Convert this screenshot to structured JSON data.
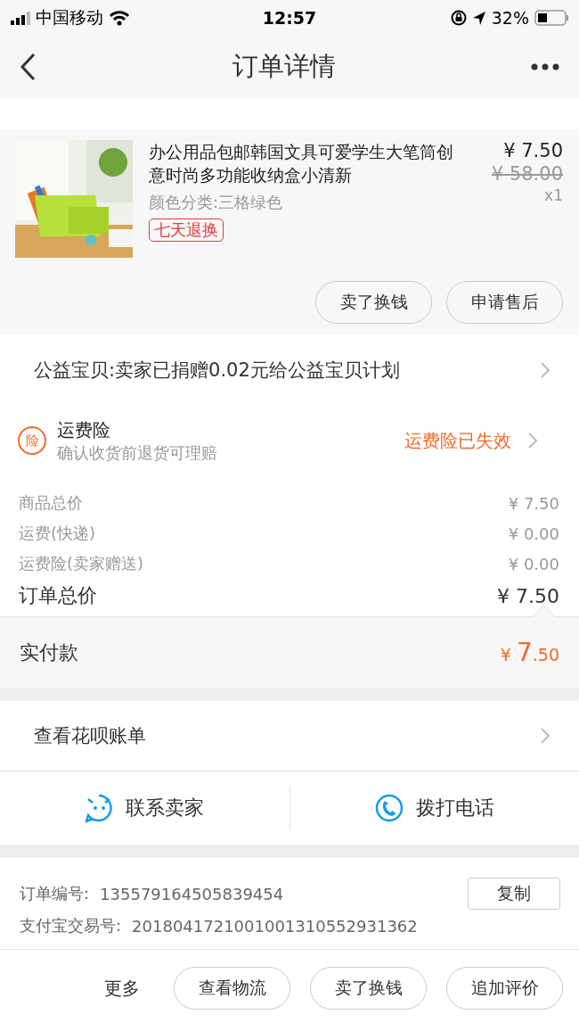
{
  "status_bar": {
    "carrier": "中国移动",
    "time": "12:57",
    "battery": "32%"
  },
  "nav": {
    "title": "订单详情"
  },
  "product": {
    "kind": "picture",
    "title": "办公用品包邮韩国文具可爱学生大笔筒创意时尚多功能收纳盒小清新",
    "sku": "颜色分类:三格绿色",
    "tag": "七天退换",
    "price": "¥ 7.50",
    "original_price": "¥ 58.00",
    "quantity": "x1",
    "buttons": [
      "卖了换钱",
      "申请售后"
    ]
  },
  "charity": {
    "text": "公益宝贝:卖家已捐赠0.02元给公益宝贝计划"
  },
  "insurance": {
    "badge": "险",
    "title": "运费险",
    "subtitle": "确认收货前退货可理赔",
    "status": "运费险已失效"
  },
  "price_lines": [
    {
      "label": "商品总价",
      "value": "¥ 7.50",
      "kind": "minor"
    },
    {
      "label": "运费(快递)",
      "value": "¥ 0.00",
      "kind": "minor"
    },
    {
      "label": "运费险(卖家赠送)",
      "value": "¥ 0.00",
      "kind": "minor"
    },
    {
      "label": "订单总价",
      "value": "¥ 7.50",
      "kind": "total"
    }
  ],
  "paid": {
    "label": "实付款",
    "currency": "¥",
    "integer": "7",
    "decimal": ".50"
  },
  "huabei": {
    "text": "查看花呗账单"
  },
  "contact": [
    {
      "kind": "chat",
      "label": "联系卖家"
    },
    {
      "kind": "phone",
      "label": "拨打电话"
    }
  ],
  "order_info": [
    {
      "label": "订单编号:",
      "value": "135579164505839454",
      "copy": "复制"
    },
    {
      "label": "支付宝交易号:",
      "value": "2018041721001001310552931362"
    }
  ],
  "bottom_bar": {
    "more": "更多",
    "buttons": [
      "查看物流",
      "卖了换钱",
      "追加评价"
    ]
  }
}
